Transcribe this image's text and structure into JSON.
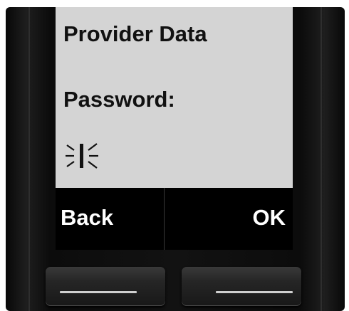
{
  "screen": {
    "title": "Provider Data",
    "field_label": "Password:",
    "field_value": ""
  },
  "softkeys": {
    "left_label": "Back",
    "right_label": "OK"
  },
  "icons": {
    "cursor": "blinking-text-cursor-icon",
    "left_hw": "left-softkey-line-icon",
    "right_hw": "right-softkey-line-icon"
  },
  "colors": {
    "display_background": "#d4d4d4",
    "display_text": "#111111",
    "softkey_bar": "#000000",
    "softkey_text": "#ffffff",
    "handset_body": "#121212"
  }
}
